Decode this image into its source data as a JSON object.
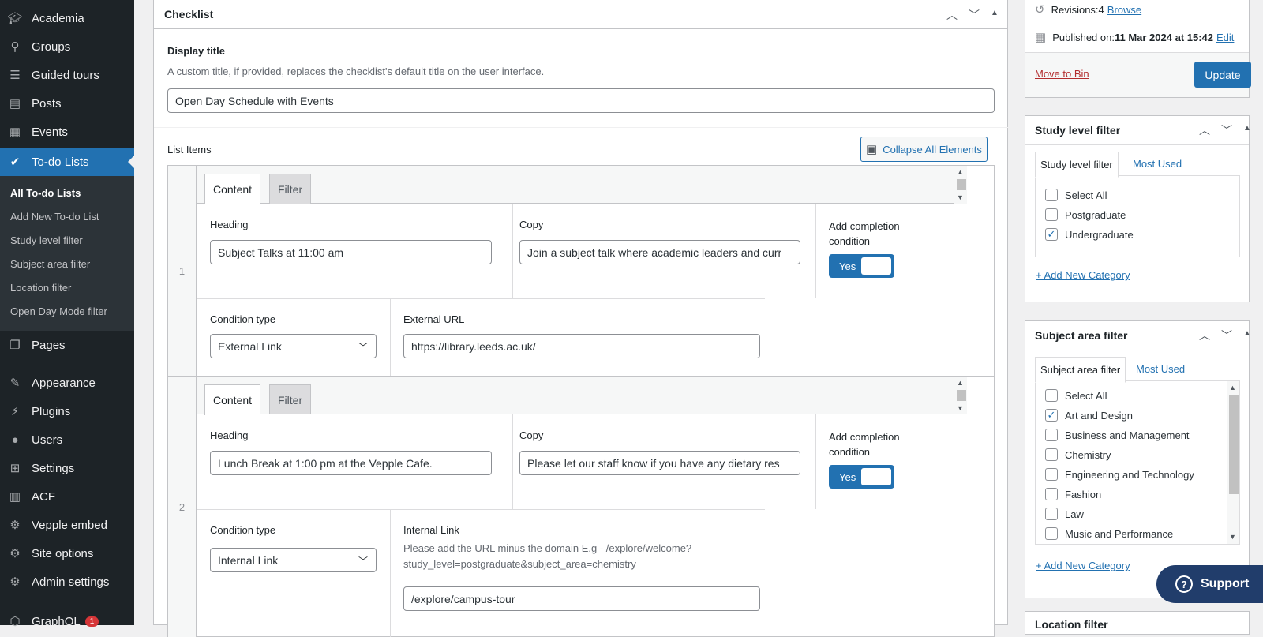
{
  "sidebar": {
    "items": [
      {
        "label": "Academia",
        "icon": "cap-icon"
      },
      {
        "label": "Groups",
        "icon": "pin-icon"
      },
      {
        "label": "Guided tours",
        "icon": "list-icon"
      },
      {
        "label": "Posts",
        "icon": "pushpin-icon"
      },
      {
        "label": "Events",
        "icon": "calendar-icon"
      },
      {
        "label": "To-do Lists",
        "icon": "check-circle-icon"
      },
      {
        "label": "Pages",
        "icon": "pages-icon"
      },
      {
        "label": "Appearance",
        "icon": "brush-icon"
      },
      {
        "label": "Plugins",
        "icon": "plug-icon"
      },
      {
        "label": "Users",
        "icon": "user-icon"
      },
      {
        "label": "Settings",
        "icon": "sliders-icon"
      },
      {
        "label": "ACF",
        "icon": "grid-icon"
      },
      {
        "label": "Vepple embed",
        "icon": "gear-icon"
      },
      {
        "label": "Site options",
        "icon": "gear-icon"
      },
      {
        "label": "Admin settings",
        "icon": "gear-icon"
      },
      {
        "label": "GraphQL",
        "icon": "graphql-icon",
        "badge": "1"
      }
    ],
    "submenu": [
      "All To-do Lists",
      "Add New To-do List",
      "Study level filter",
      "Subject area filter",
      "Location filter",
      "Open Day Mode filter"
    ]
  },
  "checklist": {
    "title": "Checklist",
    "display_title_label": "Display title",
    "display_title_desc": "A custom title, if provided, replaces the checklist's default title on the user interface.",
    "display_title_value": "Open Day Schedule with Events",
    "list_items_label": "List Items",
    "collapse_label": "Collapse All Elements",
    "tab_content": "Content",
    "tab_filter": "Filter",
    "heading_label": "Heading",
    "copy_label": "Copy",
    "completion_label": "Add completion condition",
    "toggle_yes": "Yes",
    "condition_type_label": "Condition type",
    "rows": [
      {
        "num": "1",
        "heading": "Subject Talks at 11:00 am",
        "copy": "Join a subject talk where academic leaders and curr",
        "condition_type": "External Link",
        "url_label": "External URL",
        "url_value": "https://library.leeds.ac.uk/"
      },
      {
        "num": "2",
        "heading": "Lunch Break at 1:00 pm  at the Vepple Cafe.",
        "copy": "Please let our staff know if you have any dietary res",
        "condition_type": "Internal Link",
        "url_label": "Internal Link",
        "url_desc_1": "Please add the URL minus the domain E.g - /explore/welcome?",
        "url_desc_2": "study_level=postgraduate&subject_area=chemistry",
        "url_value": "/explore/campus-tour"
      }
    ]
  },
  "publish": {
    "revisions_label": "Revisions: ",
    "revisions_count": "4",
    "browse": "Browse",
    "published_label": "Published on: ",
    "published_date": "11 Mar 2024 at 15:42",
    "edit": "Edit",
    "move_to_bin": "Move to Bin",
    "update": "Update"
  },
  "study_level": {
    "title": "Study level filter",
    "tab_all": "Study level filter",
    "tab_used": "Most Used",
    "options": [
      {
        "label": "Select All",
        "checked": false
      },
      {
        "label": "Postgraduate",
        "checked": false
      },
      {
        "label": "Undergraduate",
        "checked": true
      }
    ],
    "add_new": "+ Add New Category"
  },
  "subject_area": {
    "title": "Subject area filter",
    "tab_all": "Subject area filter",
    "tab_used": "Most Used",
    "options": [
      {
        "label": "Select All",
        "checked": false
      },
      {
        "label": "Art and Design",
        "checked": true
      },
      {
        "label": "Business and Management",
        "checked": false
      },
      {
        "label": "Chemistry",
        "checked": false
      },
      {
        "label": "Engineering and Technology",
        "checked": false
      },
      {
        "label": "Fashion",
        "checked": false
      },
      {
        "label": "Law",
        "checked": false
      },
      {
        "label": "Music and Performance",
        "checked": false
      }
    ],
    "add_new": "+ Add New Category"
  },
  "location_filter": {
    "title": "Location filter"
  },
  "support": {
    "label": "Support"
  }
}
